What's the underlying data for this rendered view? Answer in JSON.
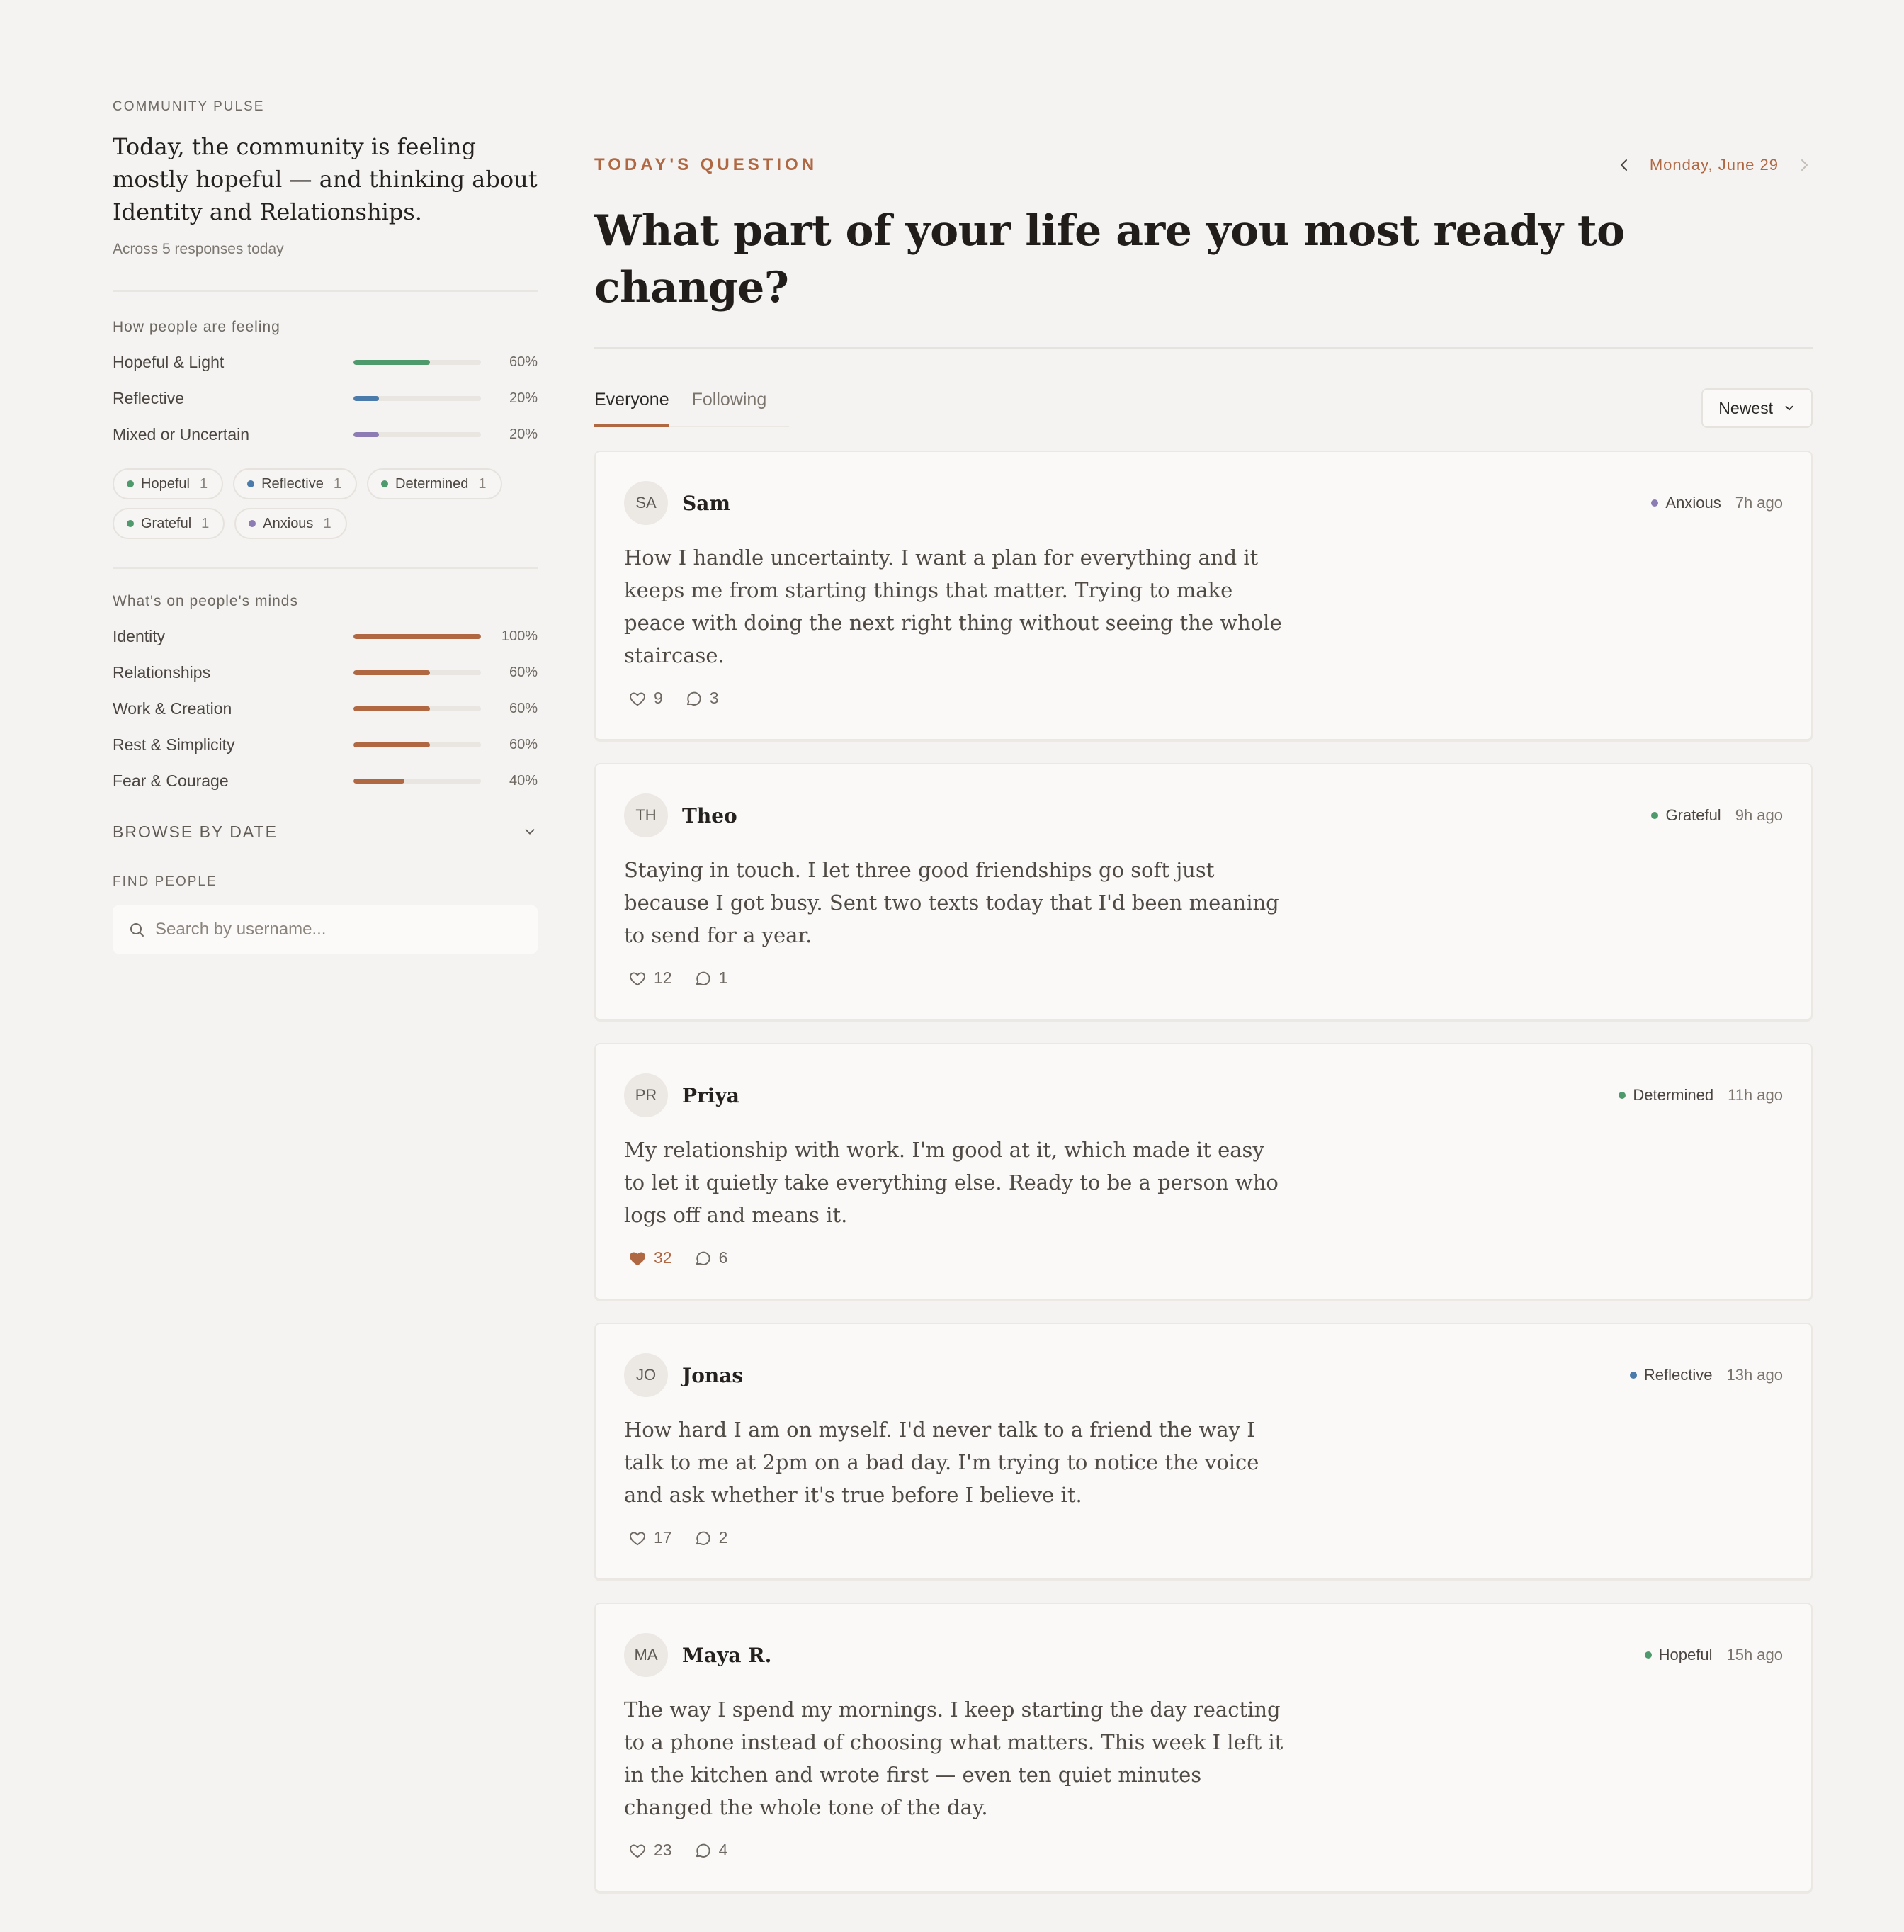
{
  "colors": {
    "accent": "#b06843",
    "hopeful": "#4f9a6c",
    "reflective": "#4a7bab",
    "mixed": "#8c7cb3",
    "topic": "#b06843",
    "background": "#f4f3f1"
  },
  "sidebar": {
    "pulse_eyebrow": "COMMUNITY PULSE",
    "pulse_text": "Today, the community is feeling mostly hopeful — and thinking about Identity and Relationships.",
    "pulse_sub": "Across 5 responses today",
    "feelings_title": "How people are feeling",
    "feelings": [
      {
        "label": "Hopeful & Light",
        "value": 60,
        "pct": "60%",
        "color": "#4f9a6c"
      },
      {
        "label": "Reflective",
        "value": 20,
        "pct": "20%",
        "color": "#4a7bab"
      },
      {
        "label": "Mixed or Uncertain",
        "value": 20,
        "pct": "20%",
        "color": "#8c7cb3"
      }
    ],
    "chips": [
      {
        "label": "Hopeful",
        "count": "1",
        "color": "#4f9a6c"
      },
      {
        "label": "Reflective",
        "count": "1",
        "color": "#4a7bab"
      },
      {
        "label": "Determined",
        "count": "1",
        "color": "#4f9a6c"
      },
      {
        "label": "Grateful",
        "count": "1",
        "color": "#4f9a6c"
      },
      {
        "label": "Anxious",
        "count": "1",
        "color": "#8c7cb3"
      }
    ],
    "minds_title": "What's on people's minds",
    "topics": [
      {
        "label": "Identity",
        "value": 100,
        "pct": "100%"
      },
      {
        "label": "Relationships",
        "value": 60,
        "pct": "60%"
      },
      {
        "label": "Work & Creation",
        "value": 60,
        "pct": "60%"
      },
      {
        "label": "Rest & Simplicity",
        "value": 60,
        "pct": "60%"
      },
      {
        "label": "Fear & Courage",
        "value": 40,
        "pct": "40%"
      }
    ],
    "browse_label": "BROWSE BY DATE",
    "find_label": "FIND PEOPLE",
    "search_placeholder": "Search by username..."
  },
  "main": {
    "eyebrow": "TODAY'S QUESTION",
    "date": "Monday, June 29",
    "question": "What part of your life are you most ready to change?",
    "tabs": [
      {
        "label": "Everyone",
        "active": true
      },
      {
        "label": "Following",
        "active": false
      }
    ],
    "sort_label": "Newest",
    "posts": [
      {
        "initials": "SA",
        "name": "Sam",
        "mood": "Anxious",
        "mood_color": "#8c7cb3",
        "time": "7h ago",
        "body": "How I handle uncertainty. I want a plan for everything and it keeps me from starting things that matter. Trying to make peace with doing the next right thing without seeing the whole staircase.",
        "likes": "9",
        "comments": "3",
        "liked": false
      },
      {
        "initials": "TH",
        "name": "Theo",
        "mood": "Grateful",
        "mood_color": "#4f9a6c",
        "time": "9h ago",
        "body": "Staying in touch. I let three good friendships go soft just because I got busy. Sent two texts today that I'd been meaning to send for a year.",
        "likes": "12",
        "comments": "1",
        "liked": false
      },
      {
        "initials": "PR",
        "name": "Priya",
        "mood": "Determined",
        "mood_color": "#4f9a6c",
        "time": "11h ago",
        "body": "My relationship with work. I'm good at it, which made it easy to let it quietly take everything else. Ready to be a person who logs off and means it.",
        "likes": "32",
        "comments": "6",
        "liked": true
      },
      {
        "initials": "JO",
        "name": "Jonas",
        "mood": "Reflective",
        "mood_color": "#4a7bab",
        "time": "13h ago",
        "body": "How hard I am on myself. I'd never talk to a friend the way I talk to me at 2pm on a bad day. I'm trying to notice the voice and ask whether it's true before I believe it.",
        "likes": "17",
        "comments": "2",
        "liked": false
      },
      {
        "initials": "MA",
        "name": "Maya R.",
        "mood": "Hopeful",
        "mood_color": "#4f9a6c",
        "time": "15h ago",
        "body": "The way I spend my mornings. I keep starting the day reacting to a phone instead of choosing what matters. This week I left it in the kitchen and wrote first — even ten quiet minutes changed the whole tone of the day.",
        "likes": "23",
        "comments": "4",
        "liked": false
      }
    ]
  }
}
